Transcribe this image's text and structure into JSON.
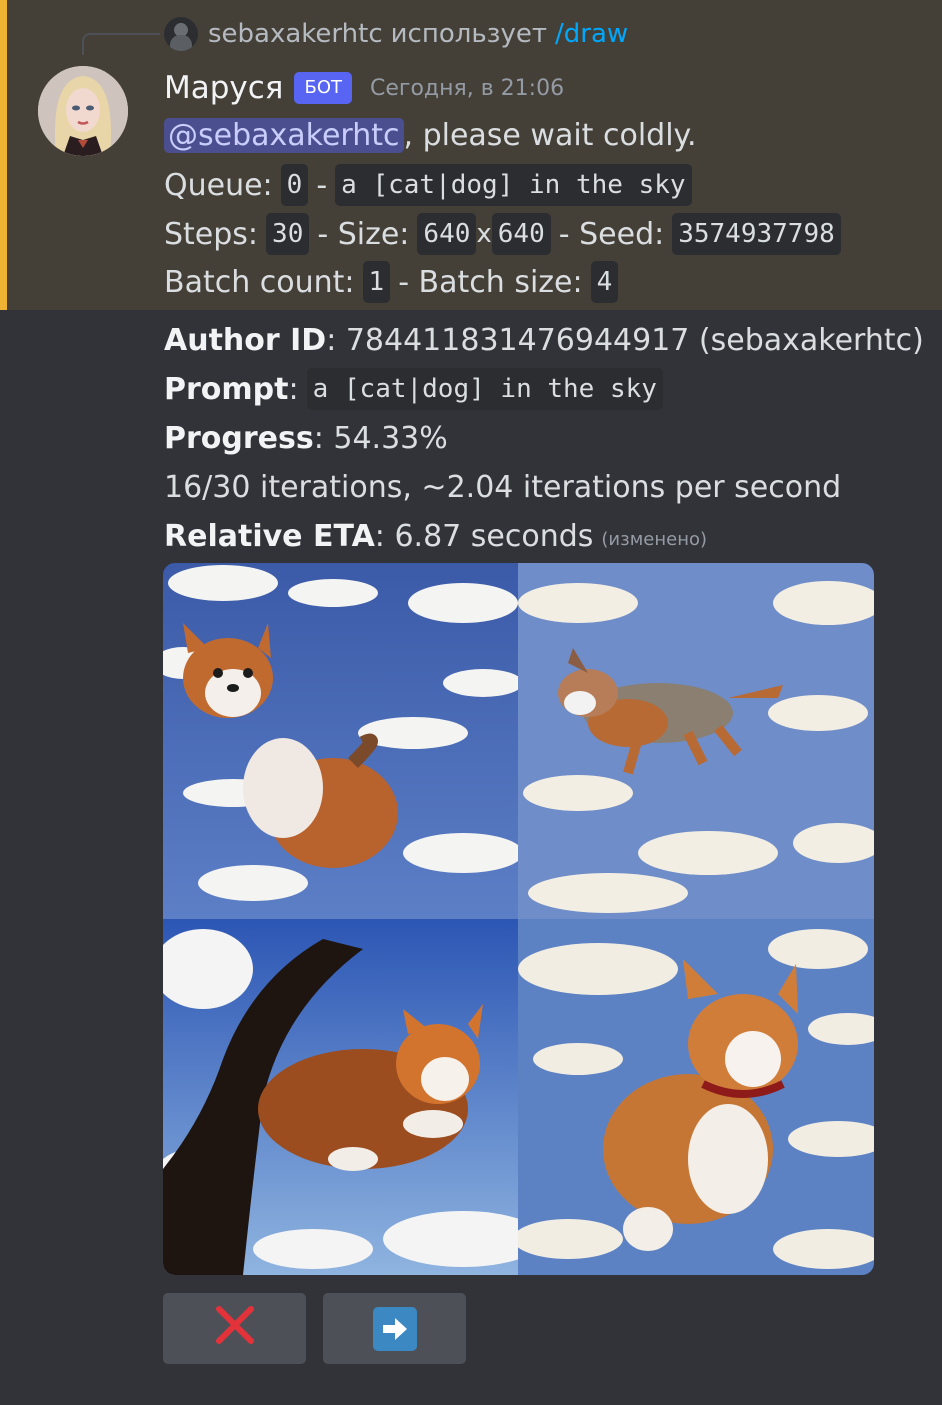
{
  "reply": {
    "username": "sebaxakerhtc",
    "verb": "использует",
    "command": "/draw"
  },
  "author": {
    "name": "Маруся",
    "tag": "БОТ",
    "timestamp": "Сегодня, в 21:06"
  },
  "message": {
    "mention": "@sebaxakerhtc",
    "greeting": ", please wait coldly.",
    "queue_label": "Queue:",
    "queue_value": "0",
    "dash": "-",
    "prompt_code": "a [cat|dog] in the sky",
    "steps_label": "Steps:",
    "steps_value": "30",
    "size_label": "- Size:",
    "width": "640",
    "x": "x",
    "height": "640",
    "seed_label": "- Seed:",
    "seed_value": "3574937798",
    "batch_count_label": "Batch count:",
    "batch_count_value": "1",
    "batch_size_label": "- Batch size:",
    "batch_size_value": "4"
  },
  "progress": {
    "author_id_label": "Author ID",
    "author_id_value": ": 784411831476944917 (sebaxakerhtc)",
    "prompt_label": "Prompt",
    "colon": ":",
    "prompt_value": "a [cat|dog] in the sky",
    "progress_label": "Progress",
    "progress_value": ": 54.33%",
    "iterations": "16/30 iterations, ~2.04 iterations per second",
    "eta_label": "Relative ETA",
    "eta_value": ": 6.87 seconds",
    "edited": "(изменено)"
  },
  "buttons": {
    "cancel_icon": "cross-mark-icon",
    "next_icon": "right-arrow-icon"
  },
  "colors": {
    "highlight_bar": "#f0b232",
    "bot_tag": "#5865f2",
    "command_link": "#00a8fc",
    "cancel": "#e4323b",
    "arrow": "#3b88c3"
  }
}
